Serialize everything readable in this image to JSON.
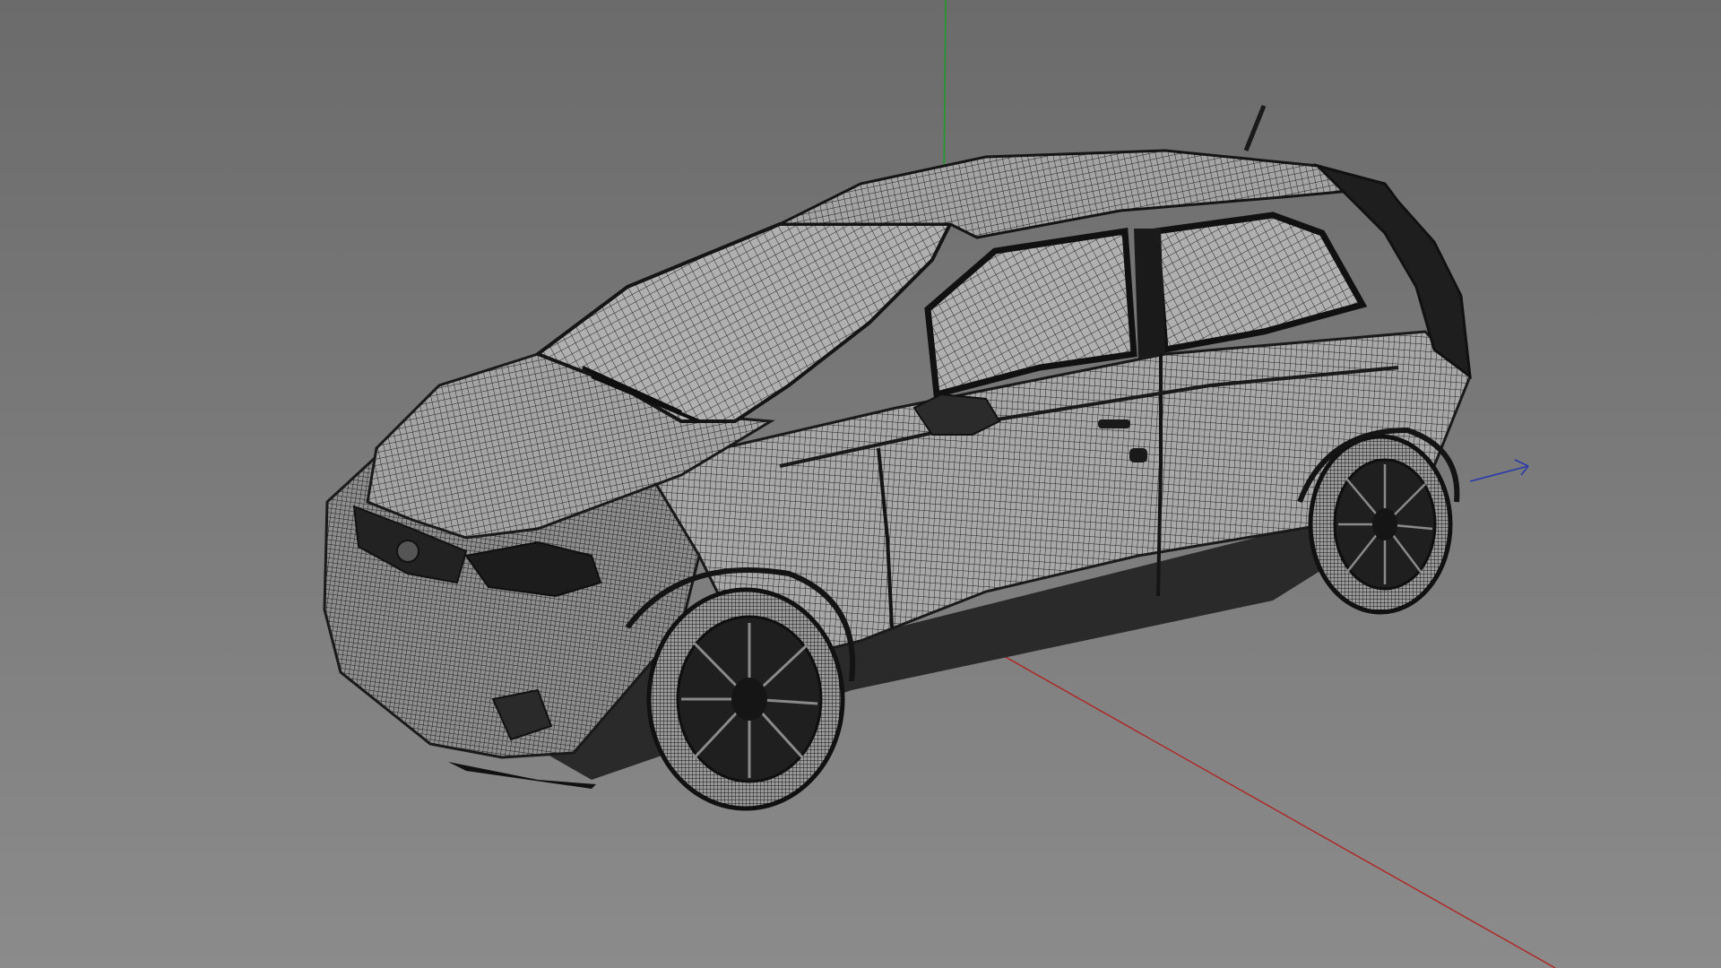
{
  "viewport": {
    "background": {
      "top_color": "#6b6b6b",
      "bottom_color": "#8a8a8a"
    },
    "display_mode": "wireframe",
    "model": {
      "semantic": "hatchback-car-mesh",
      "wire_color": "#1f1f1f",
      "surface_color": "#9a9a9a"
    },
    "axes": {
      "x_color": "#b02424",
      "y_color": "#1f9a2a",
      "z_color": "#2a3aa8"
    }
  }
}
